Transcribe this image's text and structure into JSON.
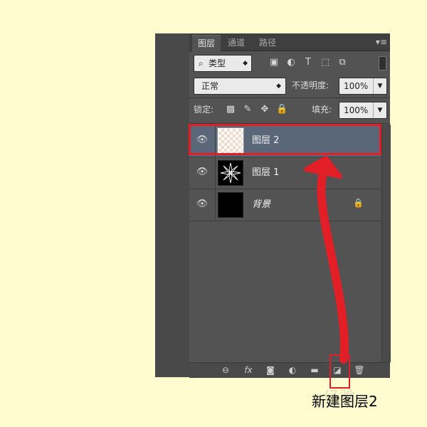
{
  "tabs": [
    {
      "label": "图层",
      "active": true
    },
    {
      "label": "通道",
      "active": false
    },
    {
      "label": "路径",
      "active": false
    }
  ],
  "filter": {
    "label": "类型",
    "icons": [
      "image-filter-icon",
      "adjustment-filter-icon",
      "type-filter-icon",
      "shape-filter-icon",
      "smart-object-filter-icon"
    ]
  },
  "blend": {
    "mode": "正常",
    "opacity_label": "不透明度:",
    "opacity_value": "100%"
  },
  "lock": {
    "label": "锁定:",
    "fill_label": "填充:",
    "fill_value": "100%"
  },
  "layers": [
    {
      "name": "图层 2",
      "selected": true,
      "thumb": "transparent"
    },
    {
      "name": "图层 1",
      "selected": false,
      "thumb": "flower"
    },
    {
      "name": "背景",
      "selected": false,
      "thumb": "black",
      "locked": true
    }
  ],
  "bottom_icons": [
    "link-icon",
    "fx-icon",
    "mask-icon",
    "adjustment-icon",
    "folder-icon",
    "new-layer-icon",
    "trash-icon"
  ],
  "annotation": {
    "caption": "新建图层2",
    "watermark": "经验",
    "accent": "#e21e26"
  }
}
